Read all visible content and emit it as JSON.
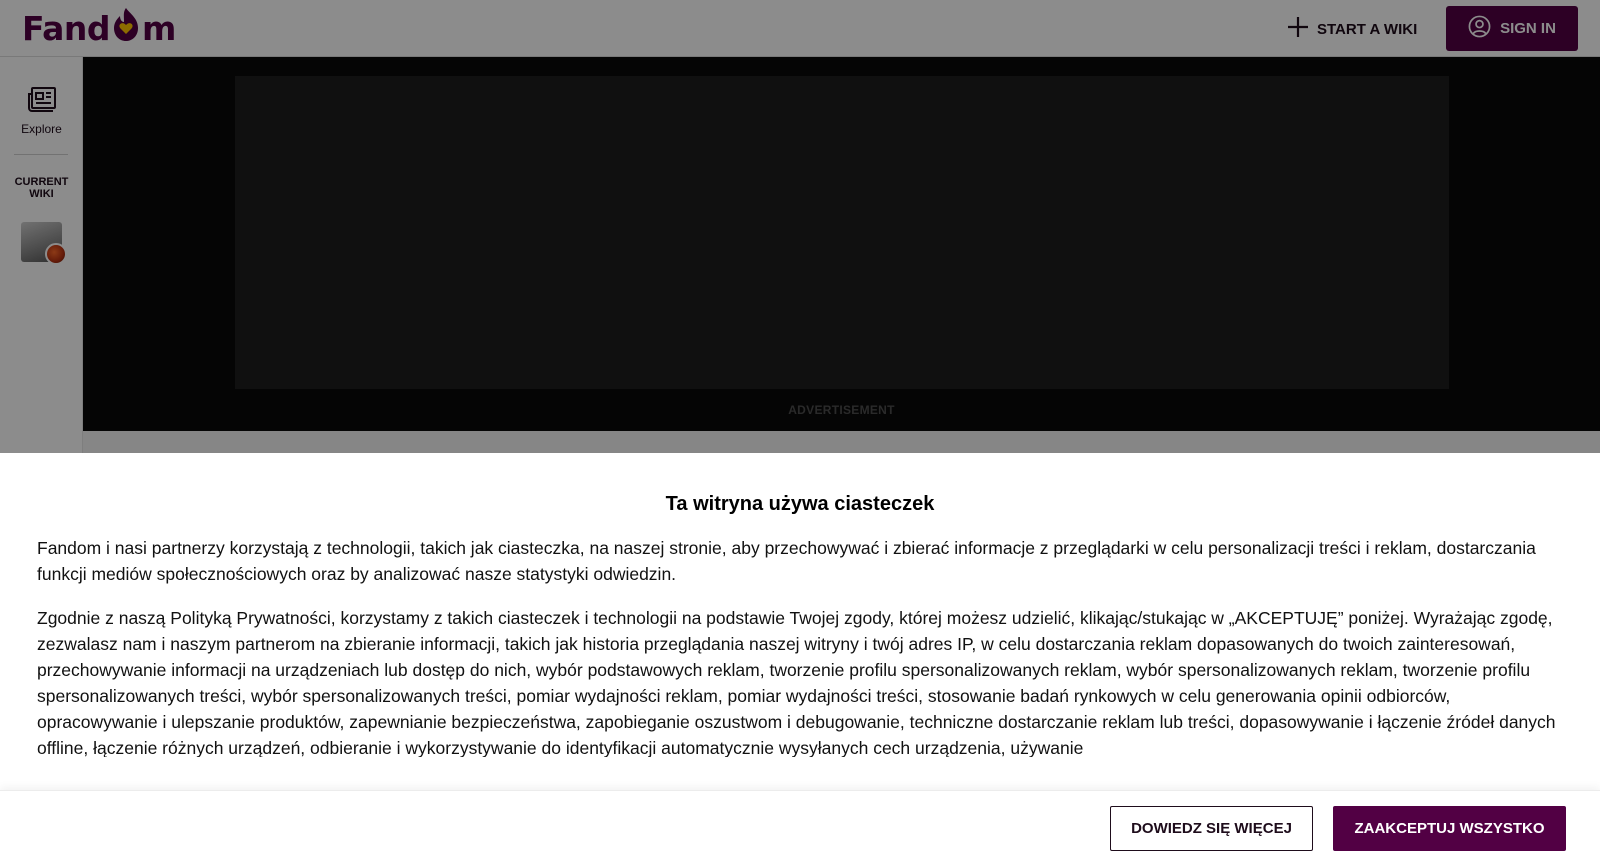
{
  "header": {
    "logo_text_left": "Fand",
    "logo_text_right": "m",
    "start_wiki_label": "START A WIKI",
    "sign_in_label": "SIGN IN"
  },
  "sidebar": {
    "explore_label": "Explore",
    "current_wiki_line1": "CURRENT",
    "current_wiki_line2": "WIKI"
  },
  "ad": {
    "label": "ADVERTISEMENT"
  },
  "cookie_banner": {
    "title": "Ta witryna używa ciasteczek",
    "paragraph1": "Fandom i nasi partnerzy korzystają z technologii, takich jak ciasteczka, na naszej stronie, aby przechowywać i zbierać informacje z przeglądarki w celu personalizacji treści i reklam, dostarczania funkcji mediów społecznościowych oraz by analizować nasze statystyki odwiedzin.",
    "paragraph2": "Zgodnie z naszą Polityką Prywatności, korzystamy z takich ciasteczek i technologii na podstawie Twojej zgody, której możesz udzielić, klikając/stukając w „AKCEPTUJĘ” poniżej. Wyrażając zgodę, zezwalasz nam i naszym partnerom na zbieranie informacji, takich jak historia przeglądania naszej witryny i twój adres IP, w celu dostarczania reklam dopasowanych do twoich zainteresowań, przechowywanie informacji na urządzeniach lub dostęp do nich, wybór podstawowych reklam, tworzenie profilu spersonalizowanych reklam, wybór spersonalizowanych reklam, tworzenie profilu spersonalizowanych treści, wybór spersonalizowanych treści, pomiar wydajności reklam, pomiar wydajności treści, stosowanie badań rynkowych w celu generowania opinii odbiorców, opracowywanie i ulepszanie produktów, zapewnianie bezpieczeństwa, zapobieganie oszustwom i debugowanie, techniczne dostarczanie reklam lub treści, dopasowywanie i łączenie źródeł danych offline, łączenie różnych urządzeń, odbieranie i wykorzystywanie do identyfikacji automatycznie wysyłanych cech urządzenia, używanie",
    "learn_more_label": "DOWIEDZ SIĘ WIĘCEJ",
    "accept_all_label": "ZAAKCEPTUJ WSZYSTKO"
  },
  "colors": {
    "brand": "#520044",
    "logo_heart": "#ffc500",
    "ad_background": "#0a0a0a"
  },
  "icons": {
    "start_wiki": "plus-icon",
    "sign_in": "user-circle-icon",
    "explore": "newspaper-icon",
    "logo_mark": "flame-heart-icon"
  }
}
